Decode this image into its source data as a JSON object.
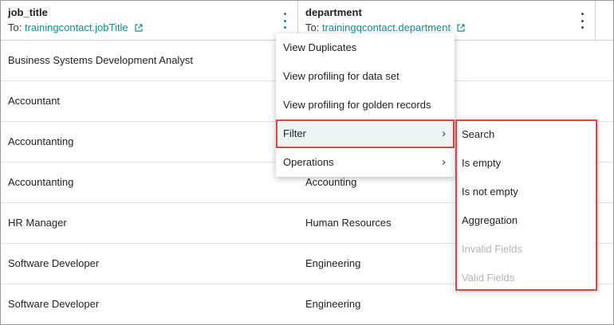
{
  "columns": [
    {
      "name": "job_title",
      "map_prefix": "To:",
      "map_link": "trainingcontact.jobTitle"
    },
    {
      "name": "department",
      "map_prefix": "To:",
      "map_link": "trainingqcontact.department"
    }
  ],
  "rows": [
    {
      "job_title": "Business Systems Development Analyst",
      "department": ""
    },
    {
      "job_title": "Accountant",
      "department": ""
    },
    {
      "job_title": "Accountanting",
      "department": ""
    },
    {
      "job_title": "Accountanting",
      "department": "Accounting"
    },
    {
      "job_title": "HR Manager",
      "department": "Human Resources"
    },
    {
      "job_title": "Software Developer",
      "department": "Engineering"
    },
    {
      "job_title": "Software Developer",
      "department": "Engineering"
    }
  ],
  "context_menu": {
    "items": [
      {
        "label": "View Duplicates"
      },
      {
        "label": "View profiling for data set"
      },
      {
        "label": "View profiling for golden records"
      },
      {
        "label": "Filter",
        "submenu": true,
        "highlighted": true
      },
      {
        "label": "Operations",
        "submenu": true
      }
    ]
  },
  "filter_submenu": {
    "items": [
      {
        "label": "Search",
        "disabled": false
      },
      {
        "label": "Is empty",
        "disabled": false
      },
      {
        "label": "Is not empty",
        "disabled": false
      },
      {
        "label": "Aggregation",
        "disabled": false
      },
      {
        "label": "Invalid Fields",
        "disabled": true
      },
      {
        "label": "Valid Fields",
        "disabled": true
      }
    ]
  },
  "icons": {
    "external_link": "external-link-icon",
    "kebab": "kebab-menu-icon",
    "chevron": "chevron-right-icon"
  },
  "colors": {
    "link": "#1a8a8a",
    "highlight_border": "#e0463f",
    "highlight_bg": "#eef5f5",
    "disabled_text": "#b5b5b5"
  }
}
